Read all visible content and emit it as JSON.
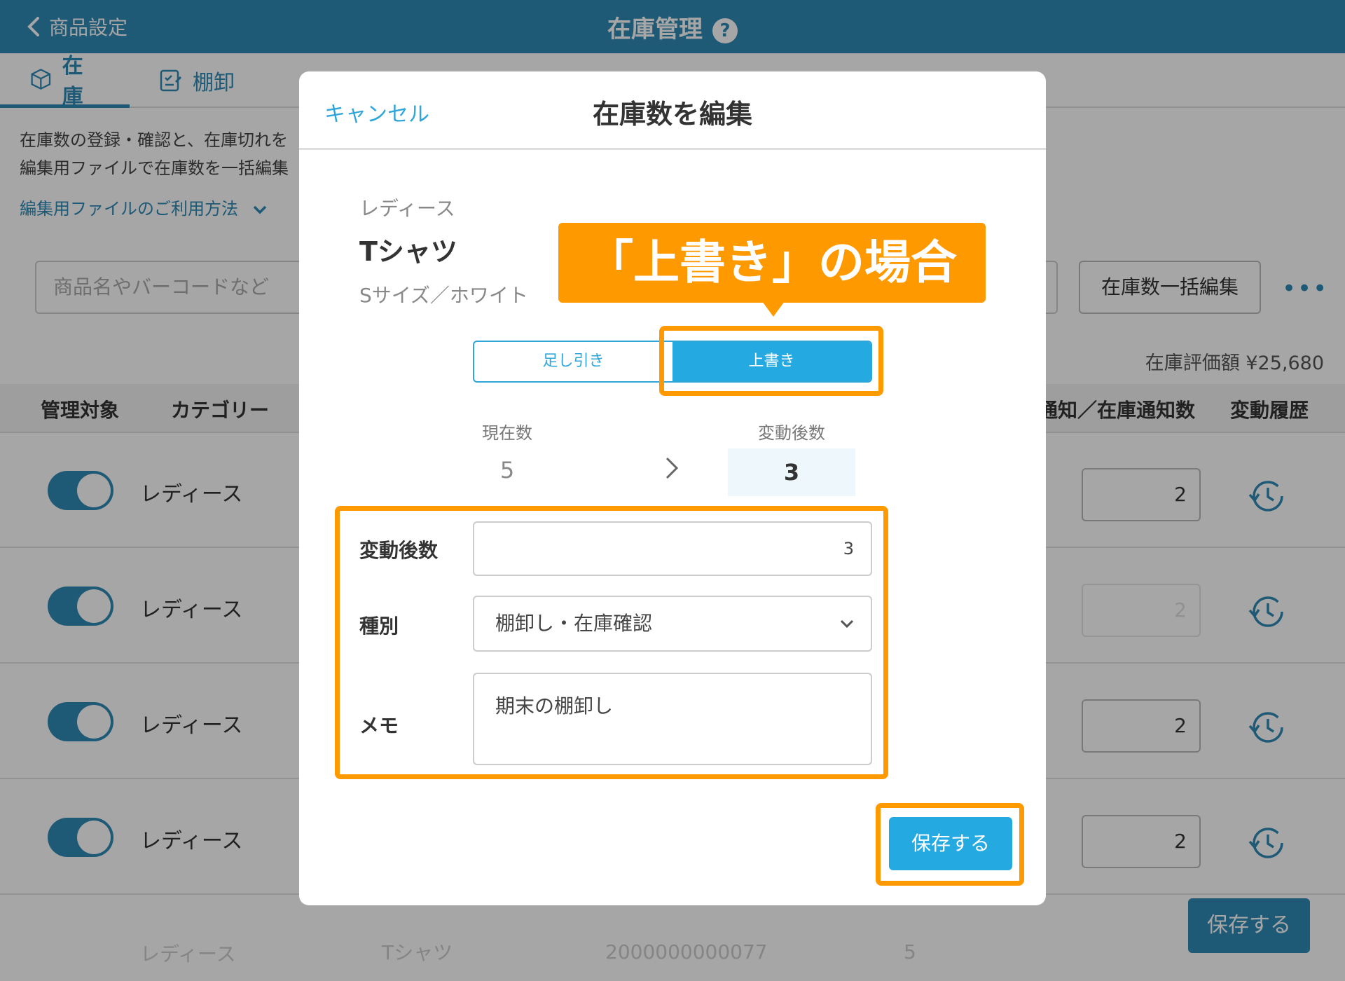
{
  "header": {
    "back_label": "商品設定",
    "title": "在庫管理",
    "help": "?"
  },
  "tabs": [
    {
      "label": "在庫",
      "active": true
    },
    {
      "label": "棚卸",
      "active": false
    }
  ],
  "description": {
    "line1": "在庫数の登録・確認と、在庫切れを",
    "line2": "編集用ファイルで在庫数を一括編集",
    "help_link": "編集用ファイルのご利用方法"
  },
  "toolbar": {
    "search_placeholder": "商品名やバーコードなど",
    "bulk_edit_label": "在庫数一括編集",
    "more_label": "•••"
  },
  "valuation": "在庫評価額 ¥25,680",
  "table": {
    "headers": {
      "managed": "管理対象",
      "category": "カテゴリー",
      "notify": "通知／在庫通知数",
      "history": "変動履歴"
    },
    "rows": [
      {
        "category": "レディース",
        "notify": "2"
      },
      {
        "category": "レディース",
        "notify": "2"
      },
      {
        "category": "レディース",
        "notify": "2"
      },
      {
        "category": "レディース",
        "notify": "2"
      }
    ],
    "faded_row": {
      "category": "レディース",
      "name": "Tシャツ",
      "barcode": "2000000000077",
      "qty": "5"
    }
  },
  "bottom_save_label": "保存する",
  "modal": {
    "cancel_label": "キャンセル",
    "title": "在庫数を編集",
    "product": {
      "category": "レディース",
      "name": "Tシャツ",
      "variant": "Sサイズ／ホワイト"
    },
    "mode": {
      "add_sub": "足し引き",
      "overwrite": "上書き",
      "selected": "overwrite"
    },
    "counts": {
      "current_label": "現在数",
      "current_value": "5",
      "after_label": "変動後数",
      "after_value": "3"
    },
    "form": {
      "qty_label": "変動後数",
      "qty_value": "3",
      "type_label": "種別",
      "type_value": "棚卸し・在庫確認",
      "memo_label": "メモ",
      "memo_value": "期末の棚卸し"
    },
    "save_label": "保存する"
  },
  "annotation": {
    "callout": "「上書き」の場合",
    "color": "#ff9900"
  },
  "colors": {
    "primary": "#2f89b5",
    "accent": "#24a9e1",
    "highlight": "#ff9900"
  }
}
